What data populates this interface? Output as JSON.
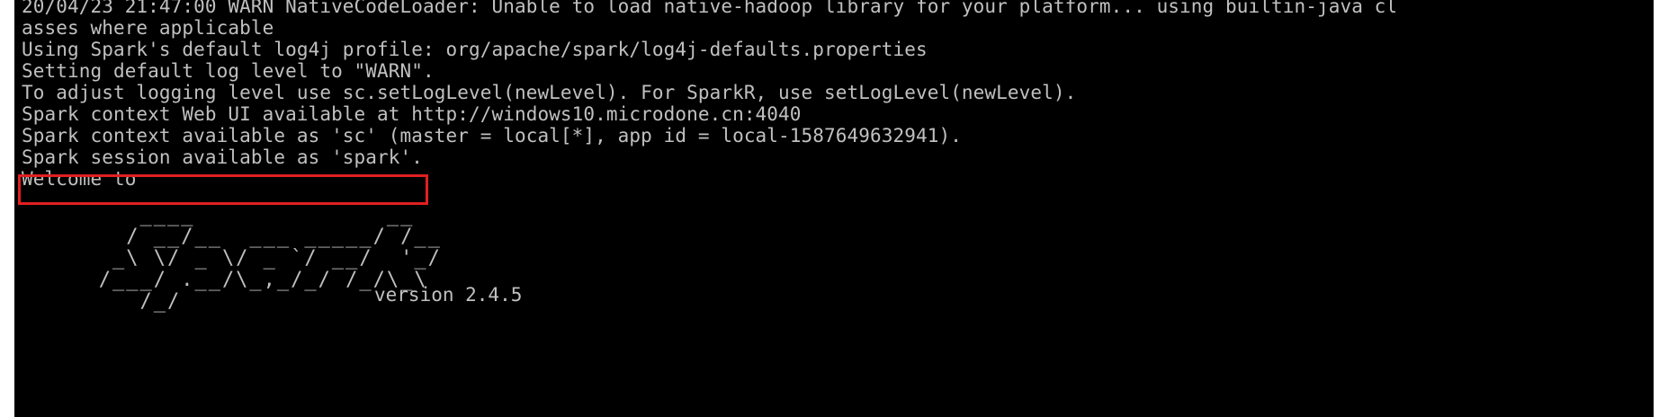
{
  "terminal": {
    "lines": [
      "20/04/23 21:47:00 WARN NativeCodeLoader: Unable to load native-hadoop library for your platform... using builtin-java cl",
      "asses where applicable",
      "Using Spark's default log4j profile: org/apache/spark/log4j-defaults.properties",
      "Setting default log level to \"WARN\".",
      "To adjust logging level use sc.setLogLevel(newLevel). For SparkR, use setLogLevel(newLevel).",
      "Spark context Web UI available at http://windows10.microdone.cn:4040",
      "Spark context available as 'sc' (master = local[*], app id = local-1587649632941).",
      "Spark session available as 'spark'.",
      "Welcome to"
    ],
    "logo": [
      "      ____              __",
      "     / __/__  ___ _____/ /__",
      "    _\\ \\/ _ \\/ _ `/ __/  '_/",
      "   /___/ .__/\\_,_/_/ /_/\\_\\",
      "      /_/"
    ],
    "version_text": "version 2.4.5",
    "highlight_color": "#e02020",
    "text_color": "#c0c0c0",
    "background_color": "#000000"
  }
}
